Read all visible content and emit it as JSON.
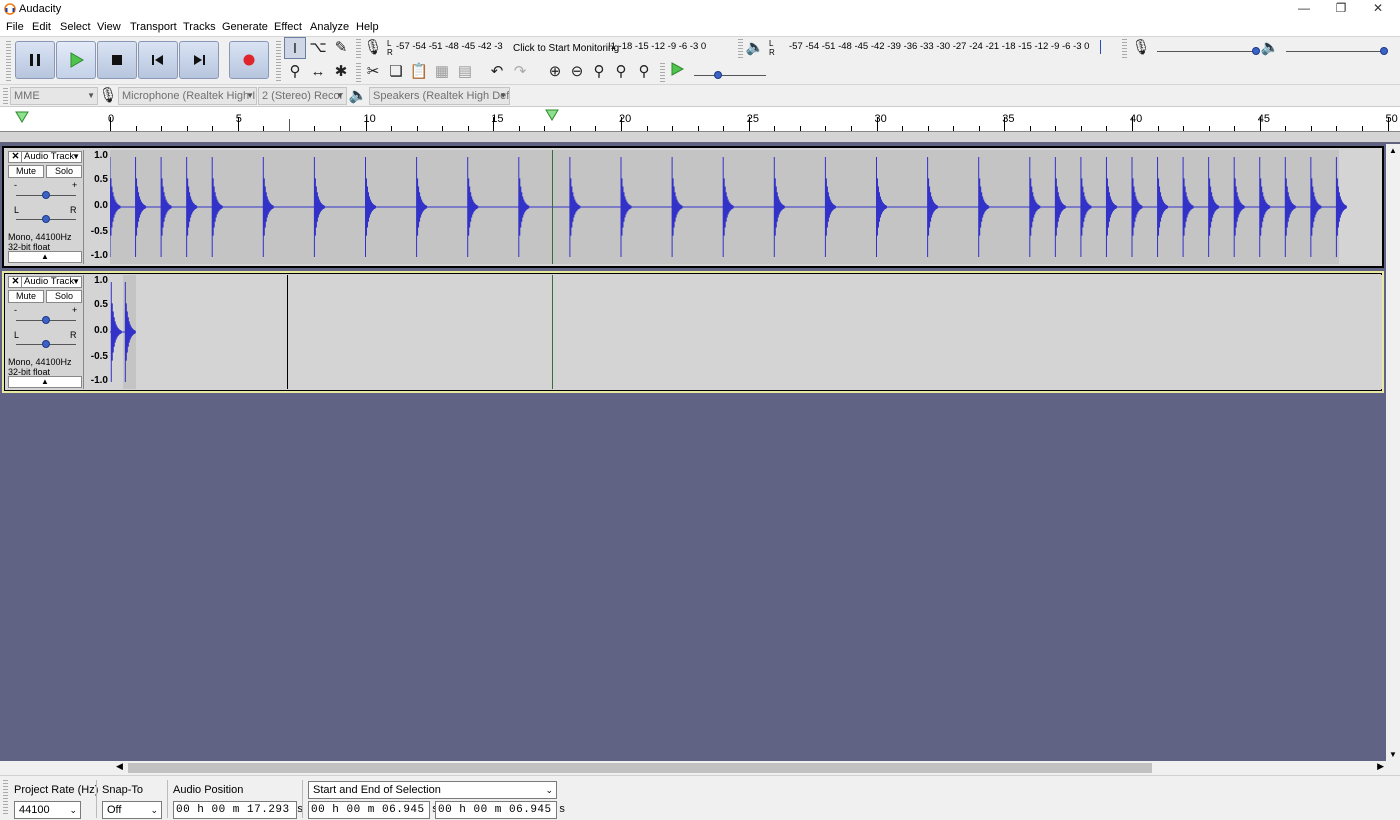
{
  "window": {
    "title": "Audacity",
    "controls": [
      "minimize",
      "restore",
      "close"
    ]
  },
  "menu": [
    "File",
    "Edit",
    "Select",
    "View",
    "Transport",
    "Tracks",
    "Generate",
    "Effect",
    "Analyze",
    "Help"
  ],
  "recording_meter": {
    "scale_left": "-57 -54 -51 -48 -45 -42 -3",
    "prompt": "Click to Start Monitoring",
    "scale_right": "!1 -18 -15 -12  -9  -6  -3  0",
    "lr": [
      "L",
      "R"
    ]
  },
  "playback_meter": {
    "scale": "-57 -54 -51 -48 -45 -42 -39 -36 -33 -30 -27 -24 -21 -18 -15 -12  -9  -6  -3  0",
    "lr": [
      "L",
      "R"
    ]
  },
  "devices": {
    "host": "MME",
    "recording_device": "Microphone (Realtek High I",
    "channels": "2 (Stereo) Recor",
    "playback_device": "Speakers (Realtek High Defi"
  },
  "ruler": {
    "labels": [
      "0",
      "5",
      "10",
      "15",
      "20",
      "25",
      "30",
      "35",
      "40",
      "45",
      "50"
    ],
    "playhead_seconds": 17.293
  },
  "tracks": [
    {
      "name": "Audio Track",
      "mute_label": "Mute",
      "solo_label": "Solo",
      "gain_minus": "-",
      "gain_plus": "+",
      "pan_left": "L",
      "pan_right": "R",
      "info_line1": "Mono, 44100Hz",
      "info_line2": "32-bit float",
      "scale": [
        "1.0",
        "0.5",
        "0.0",
        "-0.5",
        "-1.0"
      ],
      "clip_end_seconds": 48.1,
      "click_times_seconds": [
        0,
        1,
        2,
        3,
        4,
        6,
        8,
        10,
        12,
        14,
        16,
        18,
        20,
        22,
        24,
        26,
        28,
        30,
        32,
        34,
        36,
        37,
        38,
        39,
        40,
        41,
        42,
        43,
        44,
        45,
        46,
        47,
        48
      ]
    },
    {
      "name": "Audio Track",
      "mute_label": "Mute",
      "solo_label": "Solo",
      "gain_minus": "-",
      "gain_plus": "+",
      "pan_left": "L",
      "pan_right": "R",
      "info_line1": "Mono, 44100Hz",
      "info_line2": "32-bit float",
      "scale": [
        "1.0",
        "0.5",
        "0.0",
        "-0.5",
        "-1.0"
      ],
      "clip_start_seconds": 0.5,
      "clip_end_seconds": 1.0,
      "click_times_seconds": [
        0.05,
        0.6
      ]
    }
  ],
  "selection_toolbar": {
    "project_rate_label": "Project Rate (Hz)",
    "project_rate_value": "44100",
    "snap_to_label": "Snap-To",
    "snap_to_value": "Off",
    "audio_position_label": "Audio Position",
    "audio_position_value": "00 h 00 m 17.293 s",
    "selection_mode": "Start and End of Selection",
    "selection_start": "00 h 00 m 06.945 s",
    "selection_end": "00 h 00 m 06.945 s"
  },
  "colors": {
    "waveform": "#3232c8",
    "background": "#616384",
    "clip": "#c4c4c4",
    "record": "#e0242b",
    "play": "#3aa83a"
  }
}
